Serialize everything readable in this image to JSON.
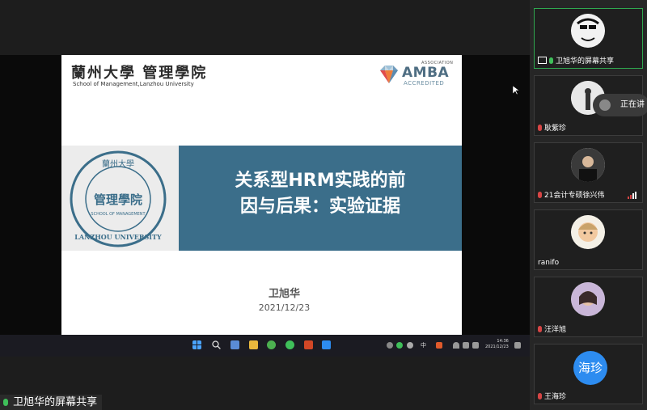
{
  "slide": {
    "logo_cn": "蘭州大學 管理學院",
    "logo_en": "School of Management,Lanzhou University",
    "amba_association": "ASSOCIATION",
    "amba_name": "AMBA",
    "amba_accredited": "ACCREDITED",
    "seal_top": "蘭州大學",
    "seal_center": "管理學院",
    "seal_en": "SCHOOL OF MANAGEMENT",
    "seal_bottom": "LANZHOU UNIVERSITY",
    "title_line1": "关系型HRM实践的前",
    "title_line2": "因与后果：实验证据",
    "author": "卫旭华",
    "date": "2021/12/23"
  },
  "taskbar": {
    "ime": "中",
    "clock_time": "14:36",
    "clock_date": "2021/12/23"
  },
  "share_label": "卫旭华的屏幕共享",
  "speaking_popup": "正在讲",
  "participants": [
    {
      "name": "卫旭华的屏幕共享",
      "mic": "on",
      "active": true
    },
    {
      "name": "耿紫珍",
      "mic": "off"
    },
    {
      "name": "21会计专硕徐兴伟",
      "mic": "off"
    },
    {
      "name": "ranifo",
      "mic": "none"
    },
    {
      "name": "汪洋旭",
      "mic": "off"
    },
    {
      "name": "王海珍",
      "mic": "off",
      "avatar_text": "海珍"
    }
  ],
  "colors": {
    "slide_blue": "#3b6e8a",
    "active_border": "#2fa84f",
    "mic_on": "#3fbf5a",
    "mic_off": "#d64545",
    "avatar_blue": "#2d8cf0"
  }
}
